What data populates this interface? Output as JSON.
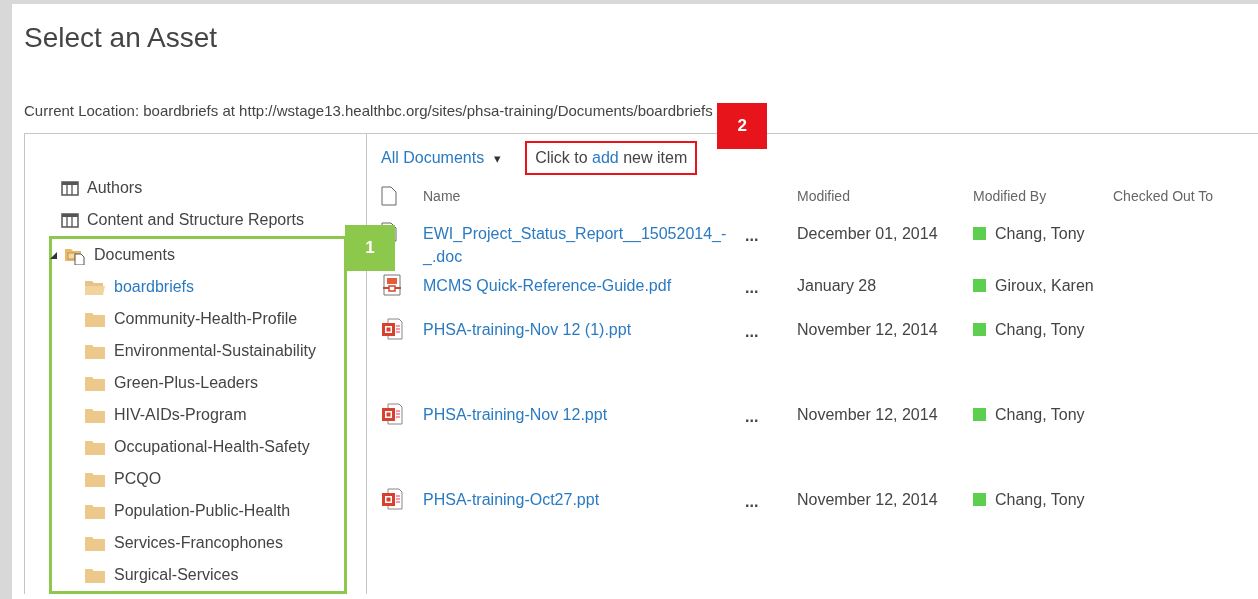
{
  "title": "Select an Asset",
  "location": "Current Location: boardbriefs at http://wstage13.healthbc.org/sites/phsa-training/Documents/boardbriefs",
  "tree": [
    {
      "label": "Authors",
      "kind": "list",
      "selected": false
    },
    {
      "label": "Content and Structure Reports",
      "kind": "list",
      "selected": false
    },
    {
      "label": "Documents",
      "kind": "library",
      "selected": false,
      "expanded": true,
      "children": [
        {
          "label": "boardbriefs",
          "selected": true
        },
        {
          "label": "Community-Health-Profile",
          "selected": false
        },
        {
          "label": "Environmental-Sustainability",
          "selected": false
        },
        {
          "label": "Green-Plus-Leaders",
          "selected": false
        },
        {
          "label": "HIV-AIDs-Program",
          "selected": false
        },
        {
          "label": "Occupational-Health-Safety",
          "selected": false
        },
        {
          "label": "PCQO",
          "selected": false
        },
        {
          "label": "Population-Public-Health",
          "selected": false
        },
        {
          "label": "Services-Francophones",
          "selected": false
        },
        {
          "label": "Surgical-Services",
          "selected": false
        }
      ]
    }
  ],
  "view": {
    "label": "All Documents",
    "caret": "▾"
  },
  "add_item": {
    "before": "Click to",
    "link": "add",
    "after": "new item"
  },
  "columns": [
    "Name",
    "Modified",
    "Modified By",
    "Checked Out To"
  ],
  "rows": [
    {
      "kind": "doc",
      "name": "EWI_Project_Status_Report__15052014_-_.doc",
      "menu": "...",
      "modified": "December 01, 2014",
      "modified_by": "Chang, Tony",
      "color": "#5ccf4e"
    },
    {
      "kind": "pdf",
      "name": "MCMS Quick-Reference-Guide.pdf",
      "menu": "...",
      "modified": "January 28",
      "modified_by": "Giroux, Karen",
      "color": "#5ccf4e"
    },
    {
      "kind": "ppt",
      "name": "PHSA-training-Nov 12 (1).ppt",
      "menu": "...",
      "modified": "November 12, 2014",
      "modified_by": "Chang, Tony",
      "color": "#5ccf4e"
    },
    {
      "kind": "ppt",
      "name": "PHSA-training-Nov 12.ppt",
      "menu": "...",
      "modified": "November 12, 2014",
      "modified_by": "Chang, Tony",
      "color": "#5ccf4e"
    },
    {
      "kind": "ppt",
      "name": "PHSA-training-Oct27.ppt",
      "menu": "...",
      "modified": "November 12, 2014",
      "modified_by": "Chang, Tony",
      "color": "#5ccf4e"
    }
  ],
  "callouts": [
    {
      "number": "1",
      "color": "#8cc84b"
    },
    {
      "number": "2",
      "color": "#e8141b"
    }
  ]
}
